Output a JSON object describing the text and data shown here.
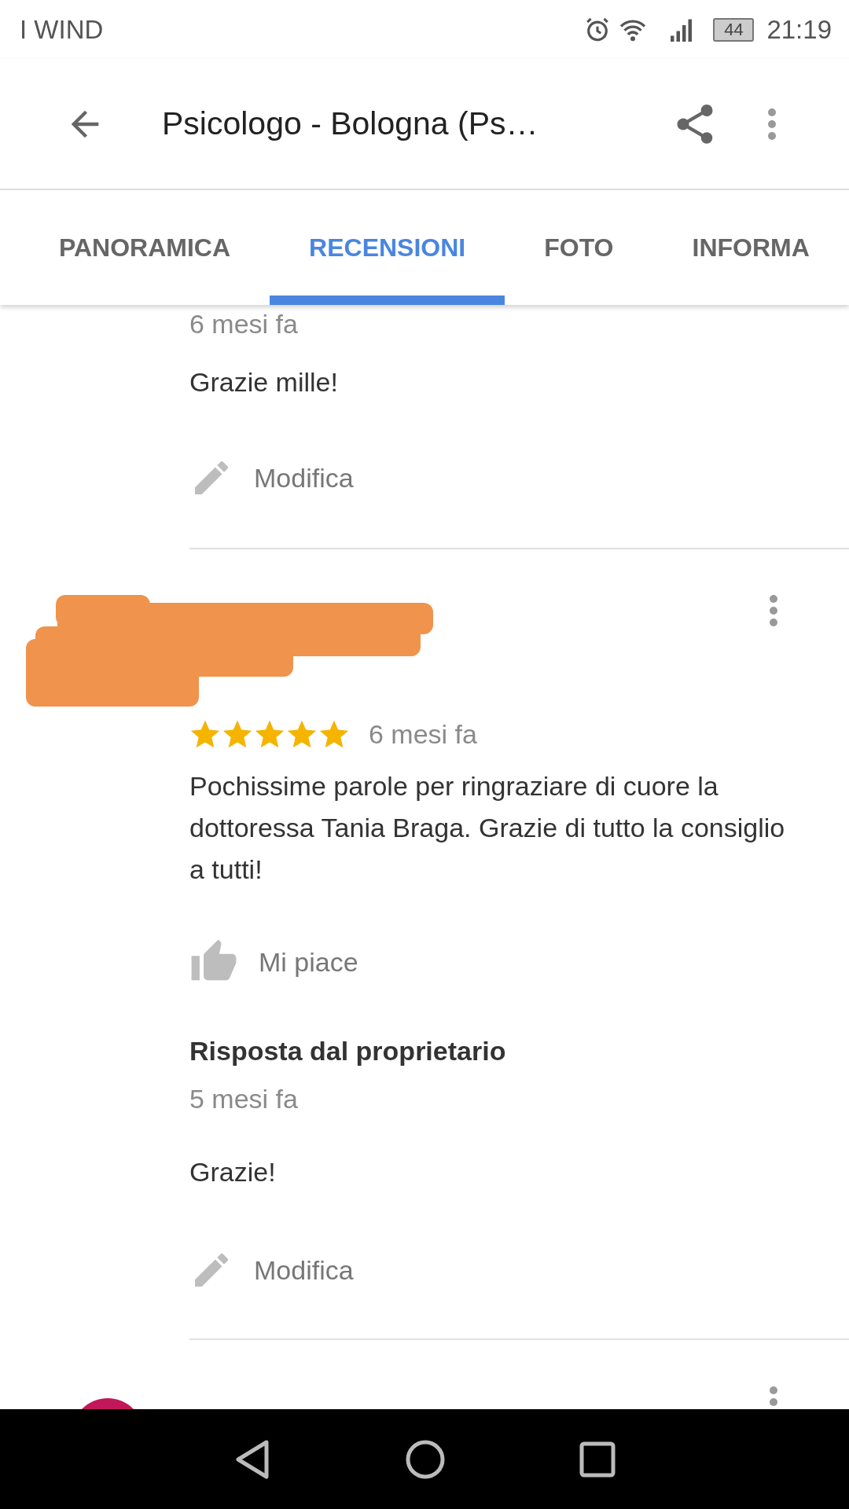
{
  "status_bar": {
    "carrier": "I WIND",
    "battery": "44",
    "time": "21:19"
  },
  "app_bar": {
    "title": "Psicologo - Bologna (Ps…"
  },
  "tabs": [
    {
      "label": "PANORAMICA",
      "selected": false
    },
    {
      "label": "RECENSIONI",
      "selected": true
    },
    {
      "label": "FOTO",
      "selected": false
    },
    {
      "label": "INFORMA",
      "selected": false
    }
  ],
  "previous_reply": {
    "time": "6 mesi fa",
    "text": "Grazie mille!",
    "edit_label": "Modifica"
  },
  "review": {
    "stars": 5,
    "time": "6 mesi fa",
    "text": "Pochissime parole per ringraziare di cuore la dottoressa Tania Braga. Grazie di tutto la consiglio a tutti!",
    "like_label": "Mi piace",
    "owner_reply": {
      "title": "Risposta dal proprietario",
      "time": "5 mesi fa",
      "text": "Grazie!",
      "edit_label": "Modifica"
    }
  }
}
